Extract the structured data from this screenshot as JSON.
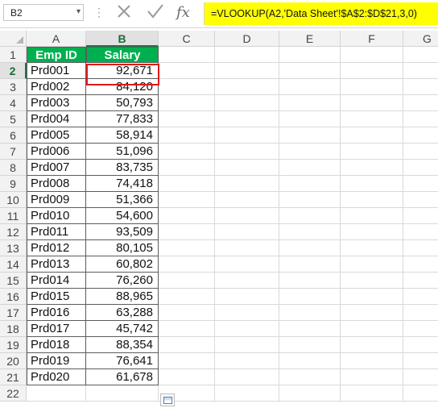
{
  "name_box": {
    "value": "B2",
    "dropdown_icon": "chevron-down-icon"
  },
  "formula_bar": {
    "cancel_icon": "close-icon",
    "enter_icon": "checkmark-icon",
    "fx_label": "fx",
    "formula": "=VLOOKUP(A2,'Data Sheet'!$A$2:$D$21,3,0)",
    "highlight_color": "#ffff00"
  },
  "columns": [
    "A",
    "B",
    "C",
    "D",
    "E",
    "F",
    "G"
  ],
  "selected_column": "B",
  "rows": [
    "1",
    "2",
    "3",
    "4",
    "5",
    "6",
    "7",
    "8",
    "9",
    "10",
    "11",
    "12",
    "13",
    "14",
    "15",
    "16",
    "17",
    "18",
    "19",
    "20",
    "21",
    "22"
  ],
  "selected_row": "2",
  "table": {
    "header_color": "#00b050",
    "headers": {
      "emp_id": "Emp ID",
      "salary": "Salary"
    },
    "records": [
      {
        "emp_id": "Prd001",
        "salary": "92,671"
      },
      {
        "emp_id": "Prd002",
        "salary": "84,120"
      },
      {
        "emp_id": "Prd003",
        "salary": "50,793"
      },
      {
        "emp_id": "Prd004",
        "salary": "77,833"
      },
      {
        "emp_id": "Prd005",
        "salary": "58,914"
      },
      {
        "emp_id": "Prd006",
        "salary": "51,096"
      },
      {
        "emp_id": "Prd007",
        "salary": "83,735"
      },
      {
        "emp_id": "Prd008",
        "salary": "74,418"
      },
      {
        "emp_id": "Prd009",
        "salary": "51,366"
      },
      {
        "emp_id": "Prd010",
        "salary": "54,600"
      },
      {
        "emp_id": "Prd011",
        "salary": "93,509"
      },
      {
        "emp_id": "Prd012",
        "salary": "80,105"
      },
      {
        "emp_id": "Prd013",
        "salary": "60,802"
      },
      {
        "emp_id": "Prd014",
        "salary": "76,260"
      },
      {
        "emp_id": "Prd015",
        "salary": "88,965"
      },
      {
        "emp_id": "Prd016",
        "salary": "63,288"
      },
      {
        "emp_id": "Prd017",
        "salary": "45,742"
      },
      {
        "emp_id": "Prd018",
        "salary": "88,354"
      },
      {
        "emp_id": "Prd019",
        "salary": "76,641"
      },
      {
        "emp_id": "Prd020",
        "salary": "61,678"
      }
    ]
  },
  "active_cell_border_color": "#e01a1a",
  "quick_analysis_icon": "quick-analysis-icon"
}
